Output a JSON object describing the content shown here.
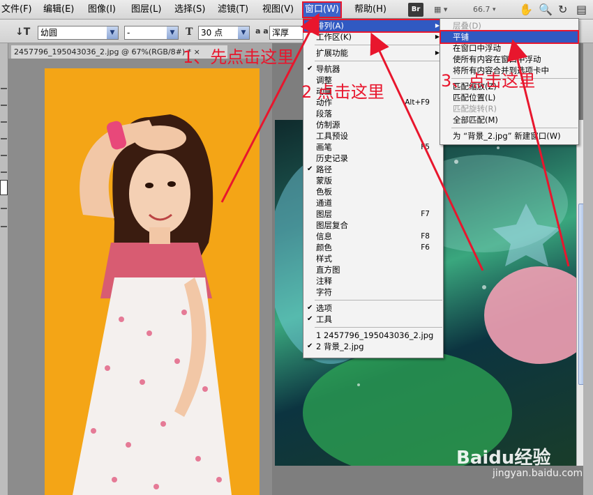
{
  "menubar": {
    "items": [
      "文件(F)",
      "编辑(E)",
      "图像(I)",
      "图层(L)",
      "选择(S)",
      "滤镜(T)",
      "视图(V)",
      "窗口(W)",
      "帮助(H)"
    ],
    "bridge_badge": "Br",
    "zoom": "66.7"
  },
  "options_bar": {
    "font_family": "幼圆",
    "font_style": "-",
    "font_size": "30 点",
    "aa_icon": "a a",
    "aa_mode": "浑厚"
  },
  "documents": {
    "doc1_tab": "2457796_195043036_2.jpg @ 67%(RGB/8#) * ×"
  },
  "window_menu": {
    "items": [
      {
        "label": "排列(A)",
        "shortcut": "",
        "check": false,
        "submenu": true,
        "highlight": true
      },
      {
        "label": "工作区(K)",
        "shortcut": "",
        "check": false,
        "submenu": true
      },
      {
        "sep": true
      },
      {
        "label": "扩展功能",
        "shortcut": "",
        "check": false,
        "submenu": true
      },
      {
        "sep": true
      },
      {
        "label": "导航器",
        "check": true
      },
      {
        "label": "调整"
      },
      {
        "label": "动画"
      },
      {
        "label": "动作",
        "shortcut": "Alt+F9"
      },
      {
        "label": "段落"
      },
      {
        "label": "仿制源"
      },
      {
        "label": "工具预设"
      },
      {
        "label": "画笔",
        "shortcut": "F5"
      },
      {
        "label": "历史记录"
      },
      {
        "label": "路径",
        "check": true
      },
      {
        "label": "蒙版"
      },
      {
        "label": "色板"
      },
      {
        "label": "通道"
      },
      {
        "label": "图层",
        "shortcut": "F7"
      },
      {
        "label": "图层复合"
      },
      {
        "label": "信息",
        "shortcut": "F8"
      },
      {
        "label": "颜色",
        "shortcut": "F6"
      },
      {
        "label": "样式"
      },
      {
        "label": "直方图"
      },
      {
        "label": "注释"
      },
      {
        "label": "字符"
      },
      {
        "sep": true
      },
      {
        "label": "选项",
        "check": true
      },
      {
        "label": "工具",
        "check": true
      },
      {
        "sep": true
      },
      {
        "label": "1 2457796_195043036_2.jpg"
      },
      {
        "label": "2 背景_2.jpg",
        "check": true
      }
    ]
  },
  "arrange_submenu": {
    "items": [
      {
        "label": "层叠(D)",
        "disabled": true
      },
      {
        "label": "平铺",
        "highlight": true
      },
      {
        "label": "在窗口中浮动"
      },
      {
        "label": "使所有内容在窗口中浮动"
      },
      {
        "label": "将所有内容合并到选项卡中"
      },
      {
        "sep": true
      },
      {
        "label": "匹配缩放(Z)"
      },
      {
        "label": "匹配位置(L)"
      },
      {
        "label": "匹配旋转(R)",
        "disabled": true
      },
      {
        "label": "全部匹配(M)"
      },
      {
        "sep": true
      },
      {
        "label": "为 “背景_2.jpg” 新建窗口(W)"
      }
    ]
  },
  "annotations": {
    "step1": "1、先点击这里",
    "step2": "2 点击这里",
    "step3": "3、点击这里",
    "color": "#e8162d"
  },
  "watermark": {
    "logo": "Baidu经验",
    "url": "jingyan.baidu.com"
  }
}
